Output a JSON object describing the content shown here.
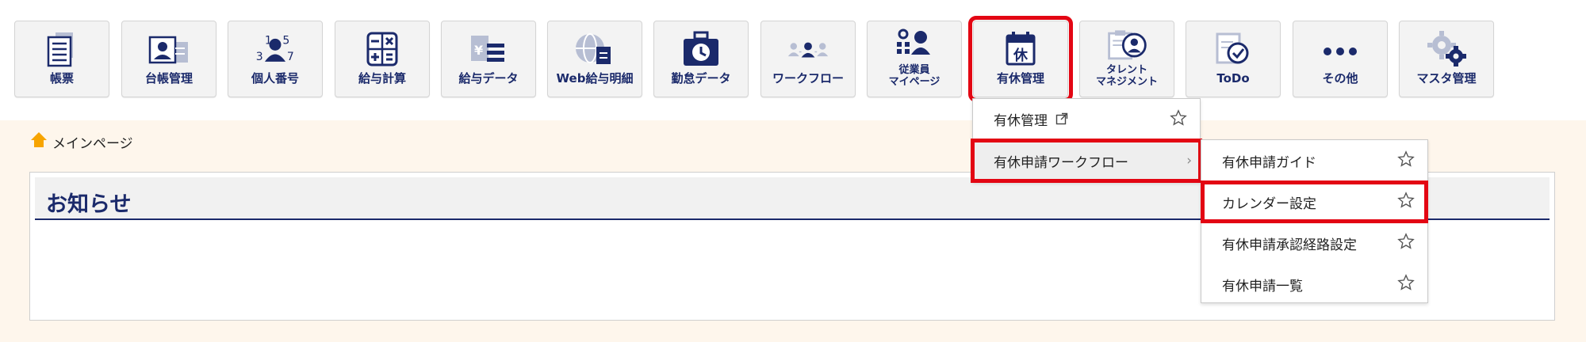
{
  "menu": {
    "tiles": [
      {
        "label": "帳票",
        "icon": "document-list-icon"
      },
      {
        "label": "台帳管理",
        "icon": "id-card-icon"
      },
      {
        "label": "個人番号",
        "icon": "person-number-icon"
      },
      {
        "label": "給与計算",
        "icon": "calculator-icon"
      },
      {
        "label": "給与データ",
        "icon": "yen-list-icon"
      },
      {
        "label": "Web給与明細",
        "icon": "globe-document-icon"
      },
      {
        "label": "勤怠データ",
        "icon": "clock-briefcase-icon"
      },
      {
        "label": "ワークフロー",
        "icon": "people-flow-icon"
      },
      {
        "label": "従業員\nマイページ",
        "icon": "employee-page-icon"
      },
      {
        "label": "有休管理",
        "icon": "calendar-leave-icon"
      },
      {
        "label": "タレント\nマネジメント",
        "icon": "talent-clipboard-icon"
      },
      {
        "label": "ToDo",
        "icon": "todo-check-icon"
      },
      {
        "label": "その他",
        "icon": "more-dots-icon"
      },
      {
        "label": "マスタ管理",
        "icon": "gears-icon"
      }
    ]
  },
  "calendar_glyph": "休",
  "breadcrumb": {
    "label": "メインページ",
    "icon": "home-icon"
  },
  "notice": {
    "title": "お知らせ"
  },
  "dropdown": {
    "items": [
      {
        "label": "有休管理",
        "icon": "external-link-icon"
      },
      {
        "label": "有休申請ワークフロー",
        "chevron": "›"
      }
    ]
  },
  "submenu": {
    "items": [
      {
        "label": "有休申請ガイド"
      },
      {
        "label": "カレンダー設定"
      },
      {
        "label": "有休申請承認経路設定"
      },
      {
        "label": "有休申請一覧"
      }
    ]
  },
  "colors": {
    "navy": "#1b2a6b",
    "highlight": "#e30613",
    "home": "#f7a400",
    "content_bg": "#fef6ec"
  }
}
